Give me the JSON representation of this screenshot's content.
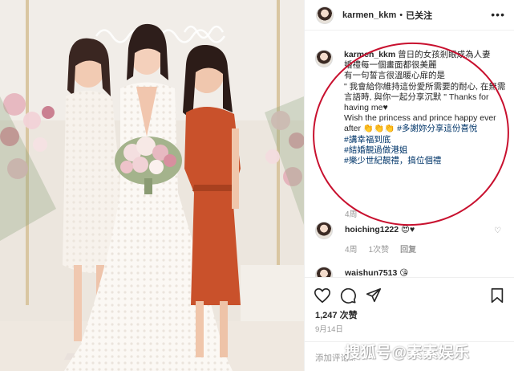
{
  "post": {
    "username": "karmen_kkm",
    "separator": "•",
    "follow_status": "已关注",
    "more_icon": "more-dots-icon"
  },
  "caption": {
    "username": "karmen_kkm",
    "lines": [
      "曾日的女孩剎眼成為人妻",
      "婚禮每一個畫面都很美麗",
      "有一句誓言很溫暖心扉的是",
      "\" 我會給你維持這份愛所需要的耐心, 在無需言語時, 與你一起分享沉默 \" Thanks for having me♥",
      "Wish the princess and prince happy ever after 👏👏👏"
    ],
    "hashtags": [
      "#多謝妳分享這份喜悅",
      "#講幸福到底",
      "#結婚靚過做港姐",
      "#樂少世紀靚禮，搞位個禮"
    ],
    "time": "4周"
  },
  "comments": [
    {
      "username": "hoiching1222",
      "text": "😍♥",
      "time": "4周",
      "likes": "1次赞",
      "reply": "回复"
    },
    {
      "username": "waishun7513",
      "text": "😘"
    }
  ],
  "actions": {
    "like_icon": "heart-icon",
    "comment_icon": "comment-icon",
    "share_icon": "share-icon",
    "save_icon": "bookmark-icon"
  },
  "likes": "1,247 次赞",
  "date": "9月14日",
  "add_comment_placeholder": "添加评论...",
  "watermark": "搜狐号@素素娱乐",
  "colors": {
    "annotation_circle": "#c8102e",
    "hashtag": "#003569"
  }
}
